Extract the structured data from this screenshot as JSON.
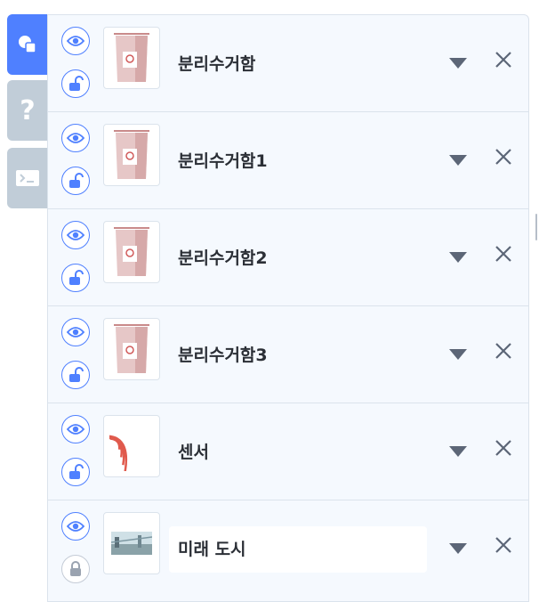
{
  "colors": {
    "accent": "#4f80ff",
    "tab_inactive": "#c1cdd8",
    "panel_bg": "#f5f9fe",
    "text": "#2b2f36",
    "trash_body": "#e6c7c7",
    "sensor_red": "#e05a4d"
  },
  "tabs": [
    {
      "name": "objects-tab",
      "icon": "shapes-icon",
      "active": true
    },
    {
      "name": "help-tab",
      "icon": "question-mark-icon",
      "glyph": "?",
      "active": false
    },
    {
      "name": "console-tab",
      "icon": "terminal-icon",
      "active": false
    }
  ],
  "objects": [
    {
      "label": "분리수거함",
      "thumbnail": "recycle-bin-icon",
      "visible": true,
      "locked": false,
      "editing": false
    },
    {
      "label": "분리수거함1",
      "thumbnail": "recycle-bin-icon",
      "visible": true,
      "locked": false,
      "editing": false
    },
    {
      "label": "분리수거함2",
      "thumbnail": "recycle-bin-icon",
      "visible": true,
      "locked": false,
      "editing": false
    },
    {
      "label": "분리수거함3",
      "thumbnail": "recycle-bin-icon",
      "visible": true,
      "locked": false,
      "editing": false
    },
    {
      "label": "센서",
      "thumbnail": "sensor-waves-icon",
      "visible": true,
      "locked": false,
      "editing": false
    },
    {
      "label": "미래 도시",
      "thumbnail": "city-background-icon",
      "visible": true,
      "locked": true,
      "editing": true
    }
  ]
}
